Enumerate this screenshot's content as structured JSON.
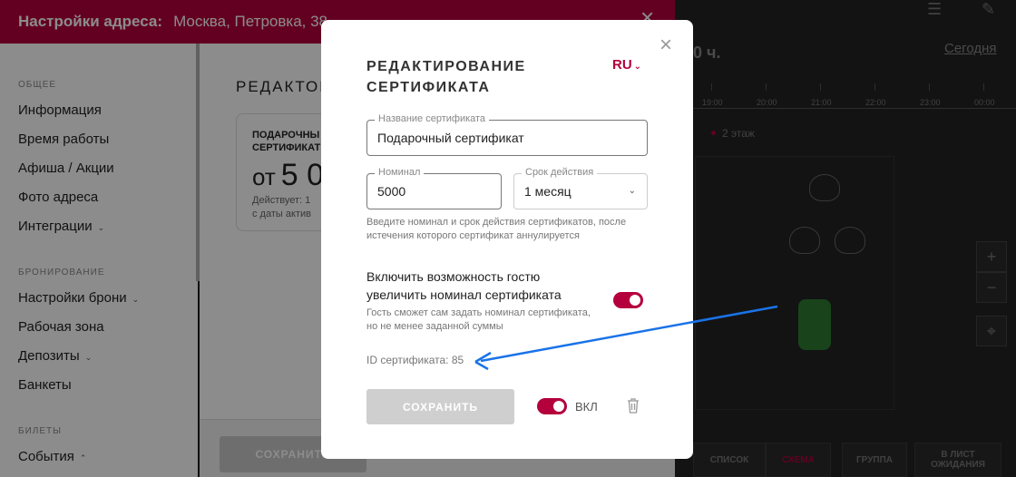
{
  "app": {
    "title_label": "Настройки адреса:",
    "address": "Москва, Петровка, 38",
    "close_icon": "close-icon",
    "brand_color": "#b4003c"
  },
  "sidebar": {
    "sections": [
      {
        "label": "ОБЩЕЕ",
        "items": [
          {
            "label": "Информация",
            "chevron": ""
          },
          {
            "label": "Время работы",
            "chevron": ""
          },
          {
            "label": "Афиша / Акции",
            "chevron": ""
          },
          {
            "label": "Фото адреса",
            "chevron": ""
          },
          {
            "label": "Интеграции",
            "chevron": "⌄"
          }
        ]
      },
      {
        "label": "БРОНИРОВАНИЕ",
        "items": [
          {
            "label": "Настройки брони",
            "chevron": "⌄"
          },
          {
            "label": "Рабочая зона",
            "chevron": ""
          },
          {
            "label": "Депозиты",
            "chevron": "⌄"
          },
          {
            "label": "Банкеты",
            "chevron": ""
          }
        ]
      },
      {
        "label": "БИЛЕТЫ",
        "items": [
          {
            "label": "События",
            "chevron": "⌃"
          }
        ]
      }
    ]
  },
  "content": {
    "heading": "РЕДАКТОР",
    "card": {
      "line1": "ПОДАРОЧНЫ",
      "line2": "СЕРТИФИКАТ",
      "price_prefix": "от",
      "price": "5 0",
      "valid_line1": "Действует: 1",
      "valid_line2": "с даты актив"
    },
    "save_label": "СОХРАНИТЬ"
  },
  "floor": {
    "hours": "0 ч.",
    "today": "Сегодня",
    "timeline": [
      "19:00",
      "20:00",
      "21:00",
      "22:00",
      "23:00",
      "00:00"
    ],
    "floor_label": "2 этаж",
    "zoom_in": "+",
    "zoom_out": "−",
    "locate_icon": "crosshair-icon",
    "tabs": [
      "СПИСОК",
      "СХЕМА",
      "ГРУППА",
      "В ЛИСТ ОЖИДАНИЯ"
    ]
  },
  "modal": {
    "title": "РЕДАКТИРОВАНИЕ СЕРТИФИКАТА",
    "lang": "RU",
    "name_label": "Название сертификата",
    "name_value": "Подарочный сертификат",
    "nominal_label": "Номинал",
    "nominal_value": "5000",
    "period_label": "Срок действия",
    "period_value": "1 месяц",
    "hint": "Введите номинал и срок действия сертификатов, после истечения которого сертификат аннулируется",
    "increase_label": "Включить возможность гостю увеличить номинал сертификата",
    "increase_hint": "Гость сможет сам задать номинал сертификата, но не менее заданной суммы",
    "increase_enabled": true,
    "cert_id": "ID сертификата: 85",
    "save_label": "СОХРАНИТЬ",
    "status_label": "ВКЛ",
    "status_enabled": true,
    "trash_icon": "trash-icon",
    "annotation_arrow_color": "#1a73e8"
  }
}
